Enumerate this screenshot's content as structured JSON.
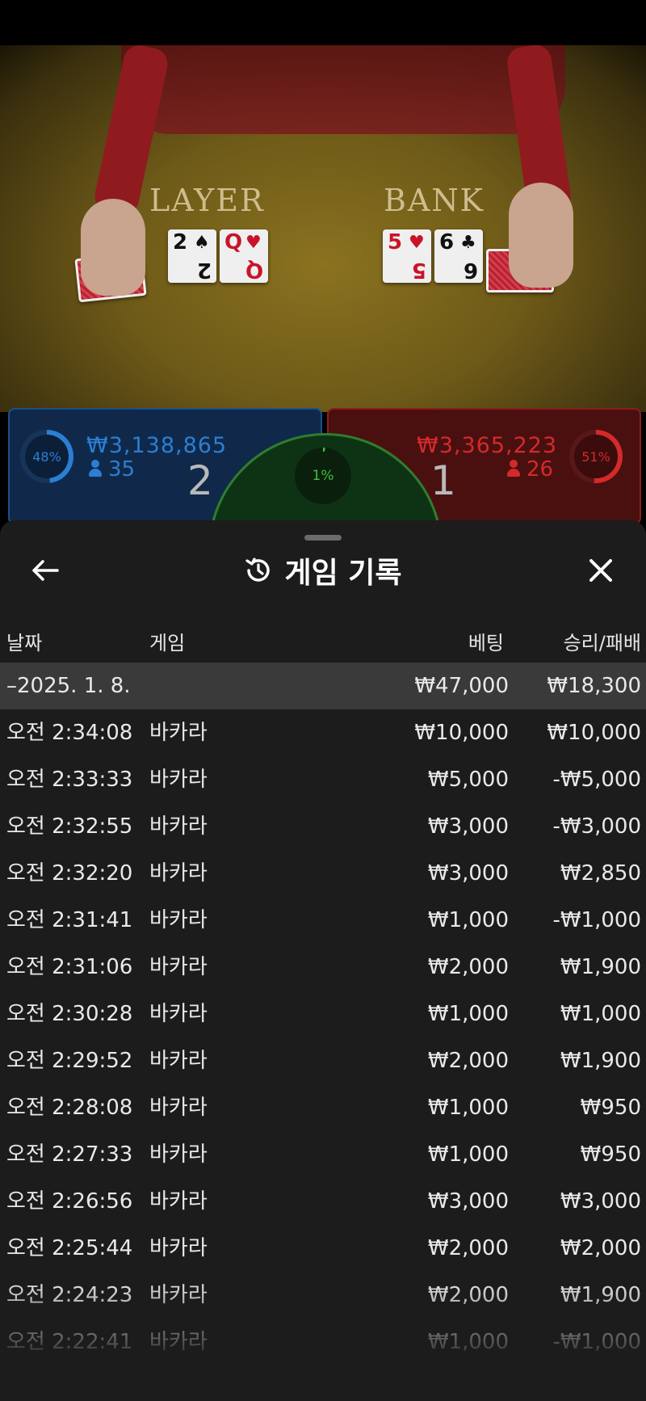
{
  "table": {
    "player_label": "LAYER",
    "banker_label": "BANK",
    "player_cards": [
      {
        "rank": "2",
        "suit": "♠",
        "color": "black"
      },
      {
        "rank": "Q",
        "suit": "♥",
        "color": "red"
      }
    ],
    "banker_cards": [
      {
        "rank": "5",
        "suit": "♥",
        "color": "red"
      },
      {
        "rank": "6",
        "suit": "♣",
        "color": "black"
      }
    ]
  },
  "bets": {
    "player": {
      "percent": "48%",
      "percent_value": 0.48,
      "amount": "₩3,138,865",
      "players": "35",
      "score": "2",
      "color": "#2a7fd4"
    },
    "banker": {
      "percent": "51%",
      "percent_value": 0.51,
      "amount": "₩3,365,223",
      "players": "26",
      "score": "1",
      "color": "#d42a2a"
    },
    "tie": {
      "percent": "1%",
      "percent_value": 0.01,
      "color": "#3fbf3f"
    }
  },
  "history": {
    "title": "게임 기록",
    "icons": {
      "back": "arrow-left-icon",
      "history": "history-icon",
      "close": "close-icon"
    },
    "columns": {
      "date": "날짜",
      "game": "게임",
      "bet": "베팅",
      "result": "승리/패배"
    },
    "summary": {
      "date": "–2025. 1. 8.",
      "bet": "₩47,000",
      "result": "₩18,300"
    },
    "rows": [
      {
        "time": "오전 2:34:08",
        "game": "바카라",
        "bet": "₩10,000",
        "result": "₩10,000"
      },
      {
        "time": "오전 2:33:33",
        "game": "바카라",
        "bet": "₩5,000",
        "result": "-₩5,000"
      },
      {
        "time": "오전 2:32:55",
        "game": "바카라",
        "bet": "₩3,000",
        "result": "-₩3,000"
      },
      {
        "time": "오전 2:32:20",
        "game": "바카라",
        "bet": "₩3,000",
        "result": "₩2,850"
      },
      {
        "time": "오전 2:31:41",
        "game": "바카라",
        "bet": "₩1,000",
        "result": "-₩1,000"
      },
      {
        "time": "오전 2:31:06",
        "game": "바카라",
        "bet": "₩2,000",
        "result": "₩1,900"
      },
      {
        "time": "오전 2:30:28",
        "game": "바카라",
        "bet": "₩1,000",
        "result": "₩1,000"
      },
      {
        "time": "오전 2:29:52",
        "game": "바카라",
        "bet": "₩2,000",
        "result": "₩1,900"
      },
      {
        "time": "오전 2:28:08",
        "game": "바카라",
        "bet": "₩1,000",
        "result": "₩950"
      },
      {
        "time": "오전 2:27:33",
        "game": "바카라",
        "bet": "₩1,000",
        "result": "₩950"
      },
      {
        "time": "오전 2:26:56",
        "game": "바카라",
        "bet": "₩3,000",
        "result": "₩3,000"
      },
      {
        "time": "오전 2:25:44",
        "game": "바카라",
        "bet": "₩2,000",
        "result": "₩2,000"
      },
      {
        "time": "오전 2:24:23",
        "game": "바카라",
        "bet": "₩2,000",
        "result": "₩1,900"
      },
      {
        "time": "오전 2:22:41",
        "game": "바카라",
        "bet": "₩1,000",
        "result": "-₩1,000"
      }
    ]
  }
}
